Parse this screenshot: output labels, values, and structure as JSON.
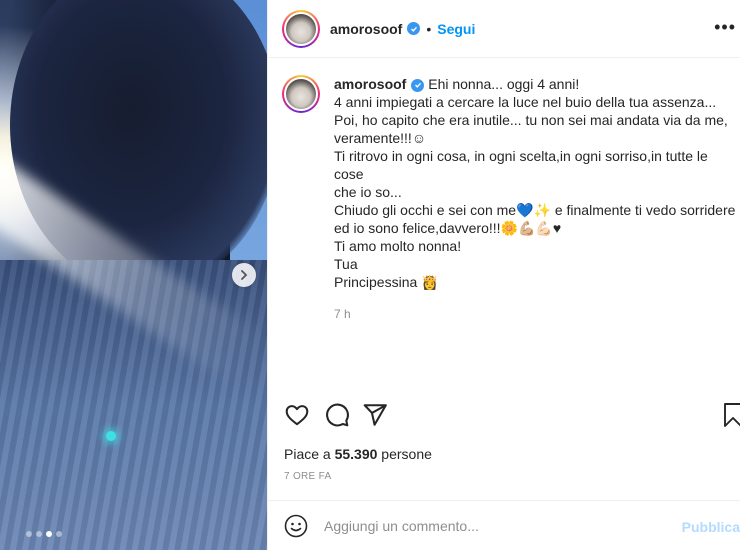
{
  "post": {
    "username": "amorosoof",
    "follow_label": "Segui",
    "separator": "•",
    "more_label": "•••"
  },
  "caption": {
    "username": "amorosoof",
    "lines": [
      "Ehi nonna... oggi 4 anni!",
      "4 anni impiegati a cercare la luce nel buio della tua assenza...",
      "Poi, ho capito che era inutile... tu non sei mai andata via da me,",
      "veramente!!!☺",
      "Ti ritrovo in ogni cosa, in ogni scelta,in ogni sorriso,in tutte le cose",
      "che io so...",
      "Chiudo gli occhi e sei con me💙✨ e finalmente ti vedo sorridere",
      "ed io sono felice,davvero!!!🌼💪🏼💪🏻♥",
      "Ti amo molto nonna!",
      "Tua",
      "Principessina 👸"
    ],
    "timestamp": "7 h"
  },
  "likes": {
    "prefix": "Piace a ",
    "count": "55.390",
    "suffix": " persone"
  },
  "post_date": "7 ORE FA",
  "comment": {
    "placeholder": "Aggiungi un commento...",
    "publish_label": "Pubblica"
  },
  "carousel": {
    "slides": 4,
    "active_index": 2
  },
  "colors": {
    "link_blue": "#0095f6",
    "verified_blue": "#3897f0",
    "publish_disabled": "#b3dbff",
    "muted_text": "#8e8e8e"
  },
  "icons": [
    "heart-icon",
    "comment-icon",
    "share-icon",
    "bookmark-icon",
    "emoji-icon",
    "verified-icon",
    "more-icon",
    "chevron-right-icon"
  ]
}
